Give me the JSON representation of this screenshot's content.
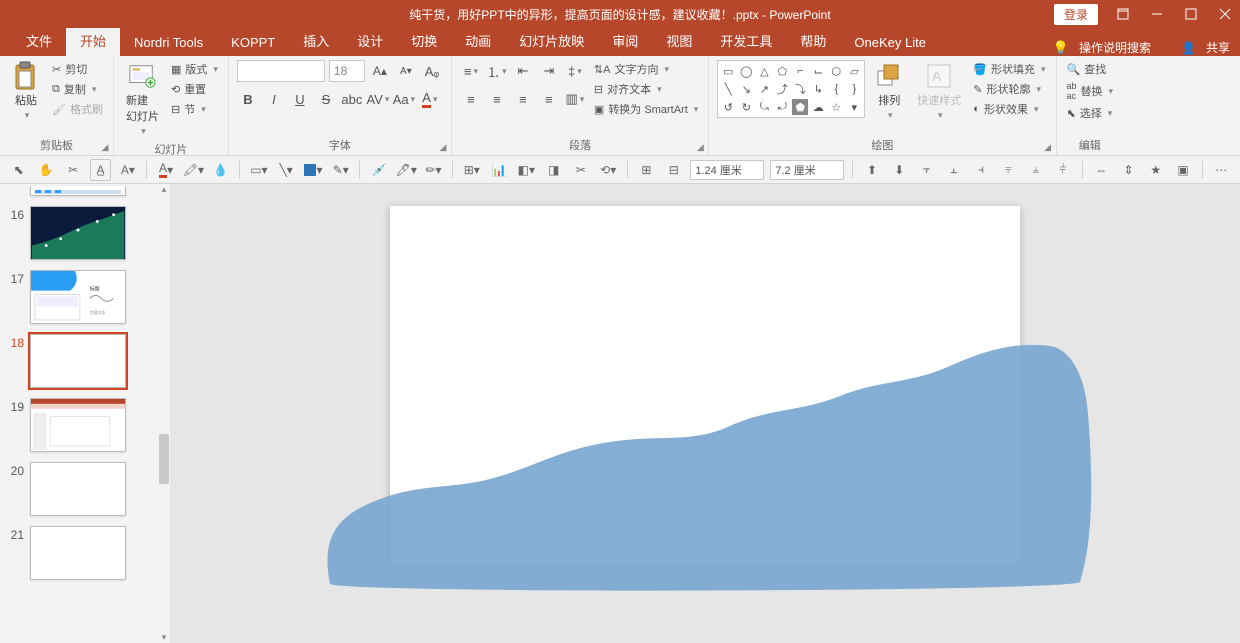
{
  "title": "纯干货，用好PPT中的异形，提高页面的设计感，建议收藏！.pptx - PowerPoint",
  "login": "登录",
  "share": "共享",
  "tell_me": "操作说明搜索",
  "tabs": [
    "文件",
    "开始",
    "Nordri Tools",
    "KOPPT",
    "插入",
    "设计",
    "切换",
    "动画",
    "幻灯片放映",
    "审阅",
    "视图",
    "开发工具",
    "帮助",
    "OneKey Lite"
  ],
  "active_tab": "开始",
  "ribbon": {
    "clipboard": {
      "label": "剪贴板",
      "paste": "粘贴",
      "cut": "剪切",
      "copy": "复制",
      "format_painter": "格式刷"
    },
    "slides": {
      "label": "幻灯片",
      "new_slide": "新建\n幻灯片",
      "layout": "版式",
      "reset": "重置",
      "section": "节"
    },
    "font": {
      "label": "字体",
      "size": "18"
    },
    "paragraph": {
      "label": "段落",
      "text_direction": "文字方向",
      "align_text": "对齐文本",
      "convert_smartart": "转换为 SmartArt"
    },
    "drawing": {
      "label": "绘图",
      "arrange": "排列",
      "quick_styles": "快速样式",
      "shape_fill": "形状填充",
      "shape_outline": "形状轮廓",
      "shape_effects": "形状效果"
    },
    "editing": {
      "label": "编辑",
      "find": "查找",
      "replace": "替换",
      "select": "选择"
    }
  },
  "qat2": {
    "width": "1.24 厘米",
    "height": "7.2 厘米"
  },
  "thumbs": [
    {
      "n": 16
    },
    {
      "n": 17
    },
    {
      "n": 18,
      "active": true
    },
    {
      "n": 19
    },
    {
      "n": 20
    },
    {
      "n": 21
    }
  ]
}
